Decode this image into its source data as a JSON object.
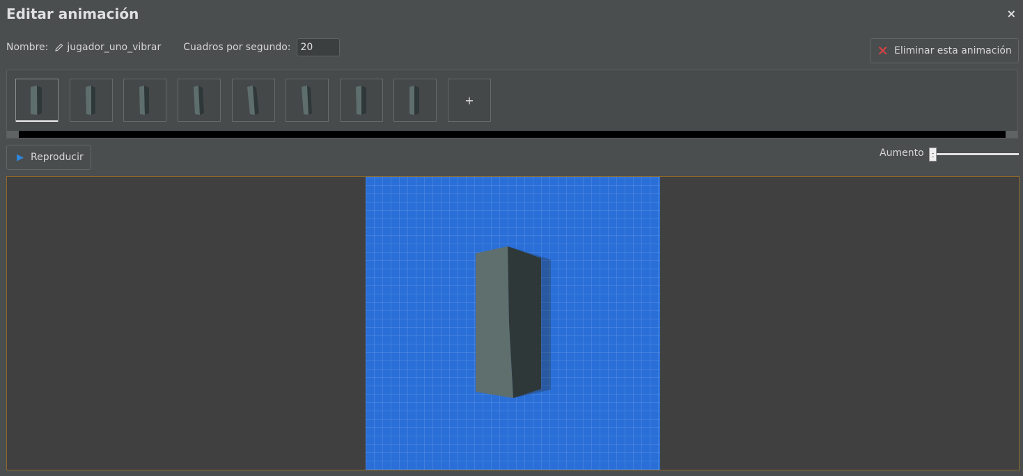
{
  "dialog": {
    "title": "Editar animación",
    "close_label": "×"
  },
  "animation": {
    "name_label": "Nombre:",
    "name_value": "jugador_uno_vibrar",
    "fps_label": "Cuadros por segundo:",
    "fps_value": "20",
    "delete_label": "Eliminar esta animación"
  },
  "frames": {
    "count": 8,
    "selected_index": 0,
    "add_label": "+"
  },
  "playback": {
    "play_label": "Reproducir",
    "zoom_label": "Aumento",
    "zoom_level": 0
  },
  "colors": {
    "accent_play": "#2e86de",
    "delete_icon": "#e04040",
    "canvas_bg": "#2a6fd8",
    "viewport_border": "#8c6a2a"
  }
}
